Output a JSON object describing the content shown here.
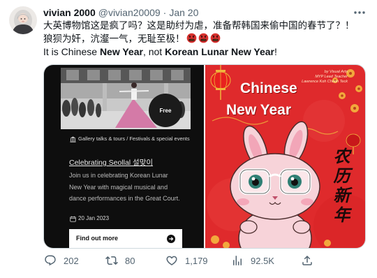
{
  "tweet": {
    "author": {
      "name": "vivian 2000",
      "handle": "@vivian20009",
      "separator": "·",
      "time": "Jan 20",
      "avatar_icon": "avatar-girl-light-hair-icon"
    },
    "more_icon": "more-icon",
    "text": {
      "line1": "大英博物馆这是疯了吗？这是助纣为虐，准备帮韩国来偷中国的春节了？！",
      "line2": "狼狈为奸，沆瀣一气，无耻至极！",
      "line2_emoji": [
        "face-with-symbols-on-mouth",
        "face-with-symbols-on-mouth",
        "face-with-symbols-on-mouth"
      ],
      "line3": [
        {
          "text": "It is Chinese ",
          "bold": false
        },
        {
          "text": "New Year",
          "bold": true
        },
        {
          "text": ", not ",
          "bold": false
        },
        {
          "text": "Korean Lunar New Year",
          "bold": true
        },
        {
          "text": "!",
          "bold": false
        }
      ]
    }
  },
  "media": {
    "museum_card": {
      "badge": "Free",
      "category_icon": "museum-building-icon",
      "category": "Gallery talks & tours / Festivals & special events",
      "title": "Celebrating Seollal 설맞이",
      "description": "Join us in celebrating Korean Lunar New Year with magical musical and dance performances in the Great Court.",
      "date_icon": "calendar-icon",
      "date": "20 Jan 2023",
      "cta": "Find out more",
      "cta_icon": "arrow-right-circle-icon"
    },
    "poster": {
      "credit": [
        "by Visual Arts",
        "MYP Lead Teacher",
        "Lawrence Koh Choon Teck"
      ],
      "title_line1": "Chinese",
      "title_line2": "New Year",
      "vertical_text": "农历新年",
      "illustration": "rabbit-with-glasses"
    }
  },
  "actions": {
    "reply": {
      "icon": "reply-icon",
      "count": "202"
    },
    "retweet": {
      "icon": "retweet-icon",
      "count": "80"
    },
    "like": {
      "icon": "heart-icon",
      "count": "1,179"
    },
    "views": {
      "icon": "views-icon",
      "count": "92.5K"
    },
    "share": {
      "icon": "share-icon"
    }
  },
  "colors": {
    "text": "#0f1419",
    "muted": "#536471",
    "card_dark": "#0e0e0e",
    "poster_red": "#df2a2c",
    "border": "#cfd9de"
  }
}
